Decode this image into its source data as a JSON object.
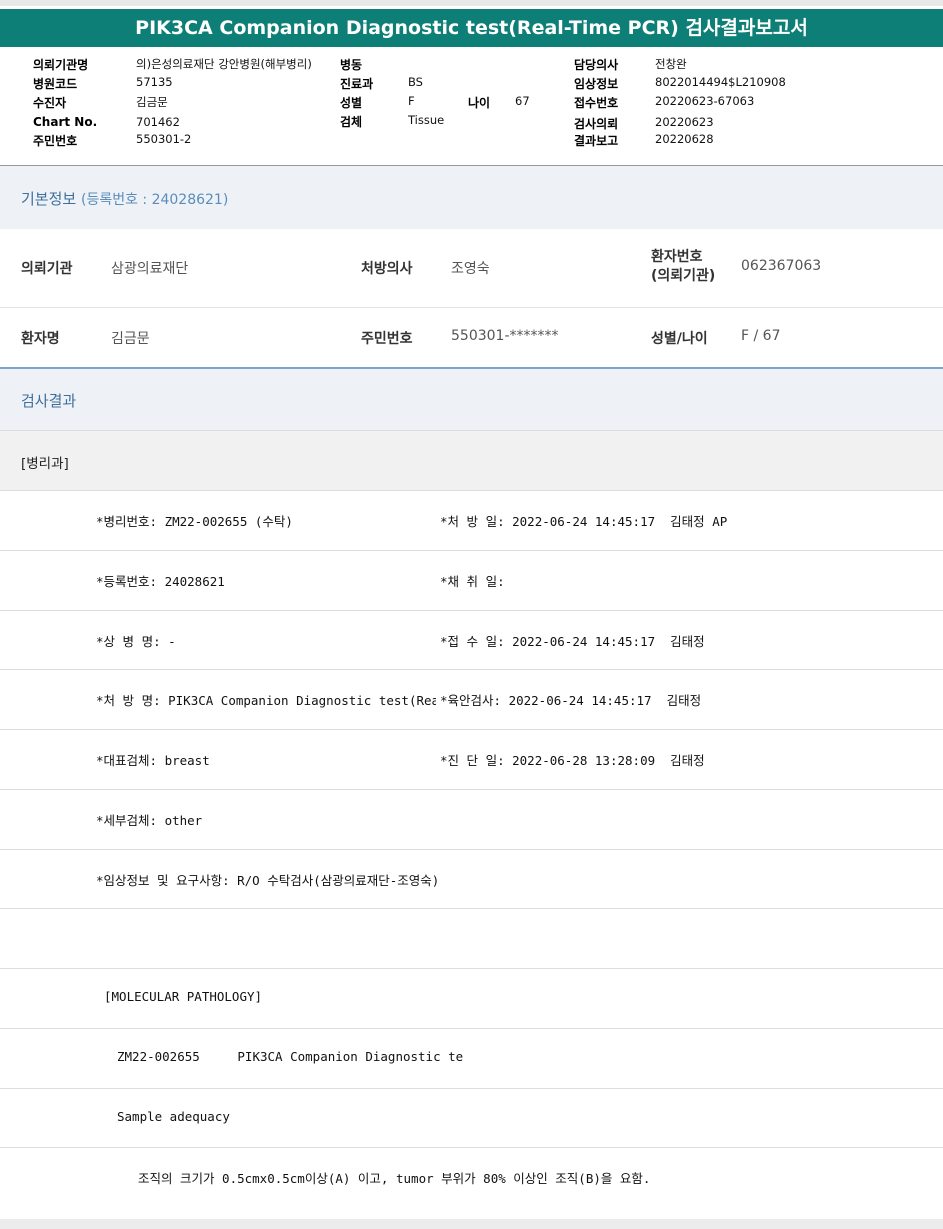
{
  "title": "PIK3CA Companion Diagnostic test(Real-Time PCR) 검사결과보고서",
  "header": {
    "col1": [
      {
        "key": "의뢰기관명",
        "value": "의)은성의료재단 강안병원(해부병리)"
      },
      {
        "key": "병원코드",
        "value": "57135"
      },
      {
        "key": "수진자",
        "value": "김금문"
      },
      {
        "key": "Chart No.",
        "value": "701462"
      },
      {
        "key": "주민번호",
        "value": "550301-2"
      }
    ],
    "col2": [
      {
        "key": "병동",
        "value": ""
      },
      {
        "key": "진료과",
        "value": "BS"
      },
      {
        "key": "성별",
        "value": "F"
      },
      {
        "key": "검체",
        "value": "Tissue"
      }
    ],
    "age": {
      "key": "나이",
      "value": "67"
    },
    "col3": [
      {
        "key": "담당의사",
        "value": "전창완"
      },
      {
        "key": "임상정보",
        "value": "8022014494$L210908"
      },
      {
        "key": "접수번호",
        "value": "20220623-67063"
      },
      {
        "key": "검사의뢰",
        "value": "20220623"
      },
      {
        "key": "결과보고",
        "value": "20220628"
      }
    ]
  },
  "basic": {
    "title": "기본정보",
    "subtitle": "(등록번호 : 24028621)",
    "row1": {
      "k1": "의뢰기관",
      "v1": "삼광의료재단",
      "k2": "처방의사",
      "v2": "조영숙",
      "k3a": "환자번호",
      "k3b": "(의뢰기관)",
      "v3": "062367063"
    },
    "row2": {
      "k1": "환자명",
      "v1": "김금문",
      "k2": "주민번호",
      "v2": "550301-*******",
      "k3": "성별/나이",
      "v3": "F / 67"
    }
  },
  "results": {
    "title": "검사결과",
    "dept": "[병리과]",
    "lines": [
      {
        "left": "*병리번호: ZM22-002655 (수탁)",
        "right": "*처 방 일: 2022-06-24 14:45:17  김태정 AP"
      },
      {
        "left": "*등록번호: 24028621",
        "right": "*채 취 일:"
      },
      {
        "left": "*상 병 명: -",
        "right": "*접 수 일: 2022-06-24 14:45:17  김태정"
      },
      {
        "left": "*처 방 명: PIK3CA Companion Diagnostic test(Rea",
        "right": "*육안검사: 2022-06-24 14:45:17  김태정"
      },
      {
        "left": "*대표검체: breast",
        "right": "*진 단 일: 2022-06-28 13:28:09  김태정"
      },
      {
        "left": "*세부검체: other",
        "right": ""
      },
      {
        "left": "*임상정보 및 요구사항: R/O 수탁검사(삼광의료재단-조영숙)",
        "right": ""
      }
    ],
    "molecular": "[MOLECULAR PATHOLOGY]",
    "test_line": "ZM22-002655     PIK3CA Companion Diagnostic te",
    "sample": "Sample adequacy",
    "note": "조직의 크기가 0.5cmx0.5cm이상(A) 이고, tumor 부위가 80% 이상인 조직(B)을 요함."
  }
}
